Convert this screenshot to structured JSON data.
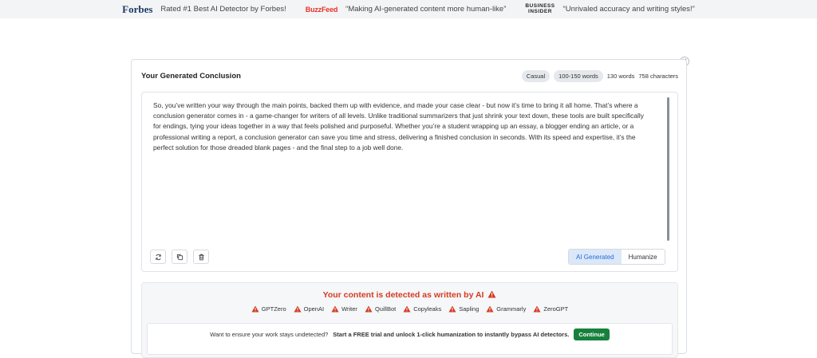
{
  "press": [
    {
      "logo": "Forbes",
      "quote": "Rated #1 Best AI Detector by Forbes!"
    },
    {
      "logo": "BuzzFeed",
      "quote": "“Making AI-generated content more human-like”"
    },
    {
      "logo_line1": "BUSINESS",
      "logo_line2": "INSIDER",
      "quote": "“Unrivaled accuracy and writing styles!”"
    }
  ],
  "card": {
    "title": "Your Generated Conclusion",
    "tone": "Casual",
    "length": "100-150 words",
    "word_count": "130 words",
    "char_count": "758 characters",
    "close_icon": "close-icon"
  },
  "output": {
    "text": "So, you’ve written your way through the main points, backed them up with evidence, and made your case clear - but now it’s time to bring it all home. That’s where a conclusion generator comes in - a game-changer for writers of all levels. Unlike traditional summarizers that just shrink your text down, these tools are built specifically for endings, tying your ideas together in a way that feels polished and purposeful. Whether you’re a student wrapping up an essay, a blogger ending an article, or a professional writing a report, a conclusion generator can save you time and stress, delivering a finished conclusion in seconds. With its speed and expertise, it’s the perfect solution for those dreaded blank pages - and the final step to a job well done."
  },
  "actions": {
    "icons": [
      "refresh-icon",
      "copy-icon",
      "trash-icon"
    ],
    "toggle_ai": "AI Generated",
    "toggle_humanize": "Humanize"
  },
  "detection": {
    "title": "Your content is detected as written by AI",
    "detectors": [
      "GPTZero",
      "OpenAI",
      "Writer",
      "QuillBot",
      "Copyleaks",
      "Sapling",
      "Grammarly",
      "ZeroGPT"
    ],
    "warning_color": "#d43b22"
  },
  "cta": {
    "prefix": "Want to ensure your work stays undetected?",
    "strong": "Start a FREE trial and unlock 1-click humanization to instantly bypass AI detectors.",
    "button": "Continue",
    "button_color": "#17803d"
  }
}
